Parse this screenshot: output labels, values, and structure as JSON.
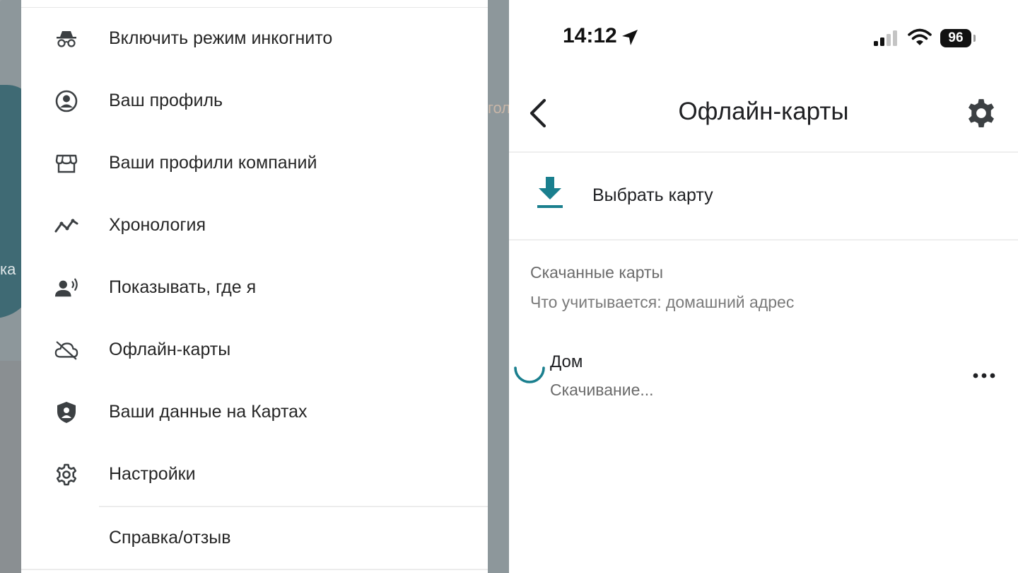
{
  "left": {
    "map_partial_texts": [
      "гол",
      "ка"
    ],
    "menu": [
      {
        "label": "Включить режим инкогнито",
        "icon": "incognito-icon"
      },
      {
        "label": "Ваш профиль",
        "icon": "account-circle-icon"
      },
      {
        "label": "Ваши профили компаний",
        "icon": "storefront-icon"
      },
      {
        "label": "Хронология",
        "icon": "timeline-icon"
      },
      {
        "label": "Показывать, где я",
        "icon": "location-sharing-icon"
      },
      {
        "label": "Офлайн-карты",
        "icon": "cloud-off-icon"
      },
      {
        "label": "Ваши данные на Картах",
        "icon": "privacy-shield-icon"
      },
      {
        "label": "Настройки",
        "icon": "gear-icon"
      },
      {
        "label": "Справка/отзыв",
        "icon": ""
      }
    ]
  },
  "right": {
    "status_bar": {
      "time": "14:12",
      "battery": "96",
      "icons": [
        "location-arrow-icon",
        "cellular-signal-icon",
        "wifi-icon",
        "battery-icon"
      ]
    },
    "header": {
      "title": "Офлайн-карты",
      "back_icon": "chevron-left-icon",
      "settings_icon": "gear-icon"
    },
    "select_map": {
      "label": "Выбрать карту",
      "icon": "download-icon",
      "accent_color": "#1a7f8e"
    },
    "downloaded": {
      "title": "Скачанные карты",
      "subtitle": "Что учитывается: домашний адрес",
      "items": [
        {
          "name": "Дом",
          "status": "Скачивание..."
        }
      ]
    }
  }
}
